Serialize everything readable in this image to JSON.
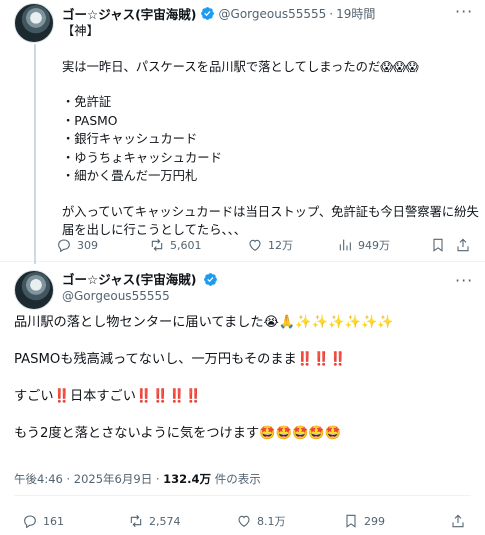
{
  "reply_tweet": {
    "author_name": "ゴー☆ジャス(宇宙海賊)",
    "handle": "@Gorgeous55555",
    "separator": "·",
    "time_ago": "19時間",
    "lines": [
      "【神】",
      "",
      "実は一昨日、パスケースを品川駅で落としてしまったのだ😱😱😱",
      "",
      "・免許証",
      "・PASMO",
      "・銀行キャッシュカード",
      "・ゆうちょキャッシュカード",
      "・細かく畳んだ一万円札",
      "",
      "が入っていてキャッシュカードは当日ストップ、免許証も今日警察署に紛失",
      "届を出しに行こうとしてたら、、、"
    ],
    "stats": {
      "replies": "309",
      "reposts": "5,601",
      "likes": "12万",
      "views": "949万"
    }
  },
  "main_tweet": {
    "author_name": "ゴー☆ジャス(宇宙海賊)",
    "handle": "@Gorgeous55555",
    "lines": [
      "品川駅の落とし物センターに届いてました😭🙏✨✨✨✨✨✨",
      "",
      "PASMOも残高減ってないし、一万円もそのまま‼️‼️‼️",
      "",
      "すごい‼️日本すごい‼️‼️‼️‼️",
      "",
      "もう2度と落とさないように気をつけます🤩🤩🤩🤩🤩"
    ],
    "timestamp": "午後4:46 · 2025年6月9日 · ",
    "view_count": "132.4万",
    "view_suffix": " 件の表示",
    "stats": {
      "replies": "161",
      "reposts": "2,574",
      "likes": "8.1万",
      "bookmarks": "299"
    }
  },
  "colors": {
    "text": "#0f1419",
    "muted": "#536471",
    "verified": "#1d9bf0",
    "divider": "#eff3f4"
  }
}
